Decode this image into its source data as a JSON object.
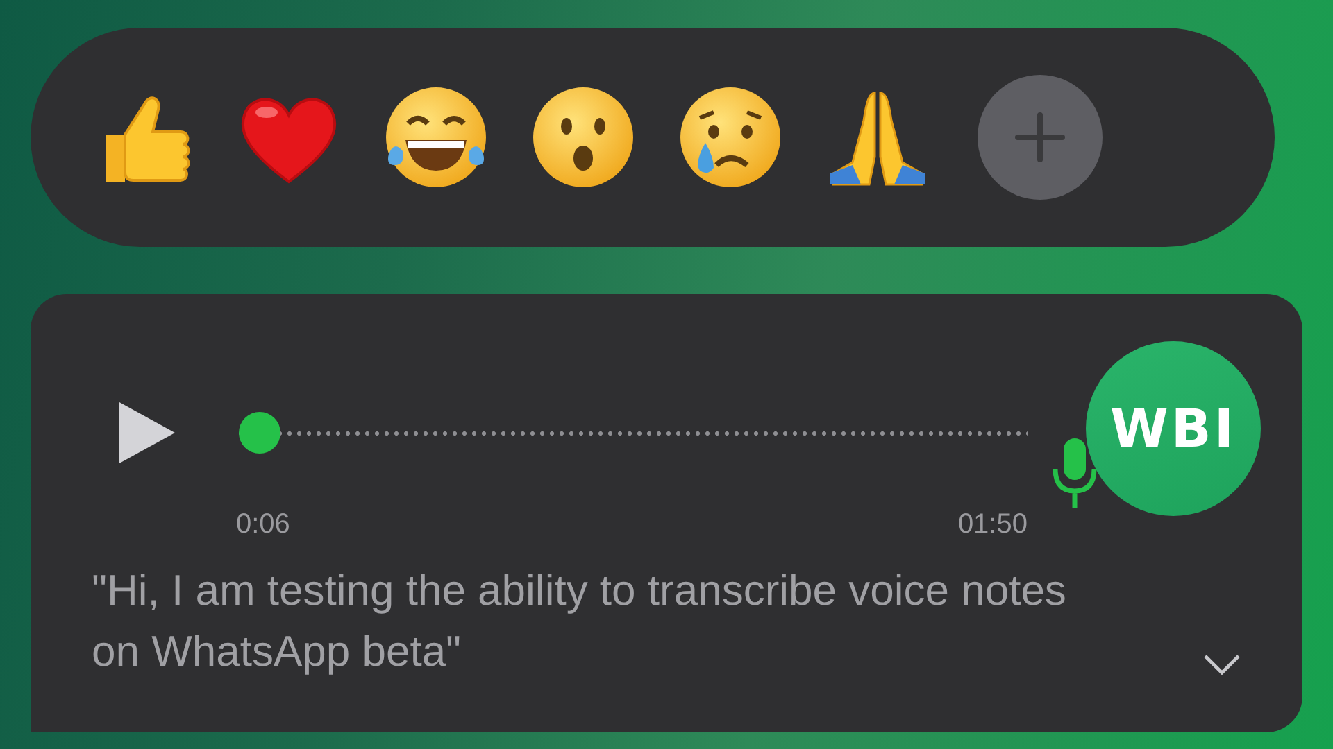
{
  "reactions": [
    {
      "kind": "thumbs_up"
    },
    {
      "kind": "heart"
    },
    {
      "kind": "laughing"
    },
    {
      "kind": "surprised"
    },
    {
      "kind": "crying"
    },
    {
      "kind": "praying"
    }
  ],
  "voice_message": {
    "avatar_text": "WBI",
    "level": 0.03,
    "elapsed": "0:06",
    "duration": "01:50",
    "transcript": "\"Hi, I am testing the ability to transcribe voice notes on WhatsApp beta\""
  }
}
